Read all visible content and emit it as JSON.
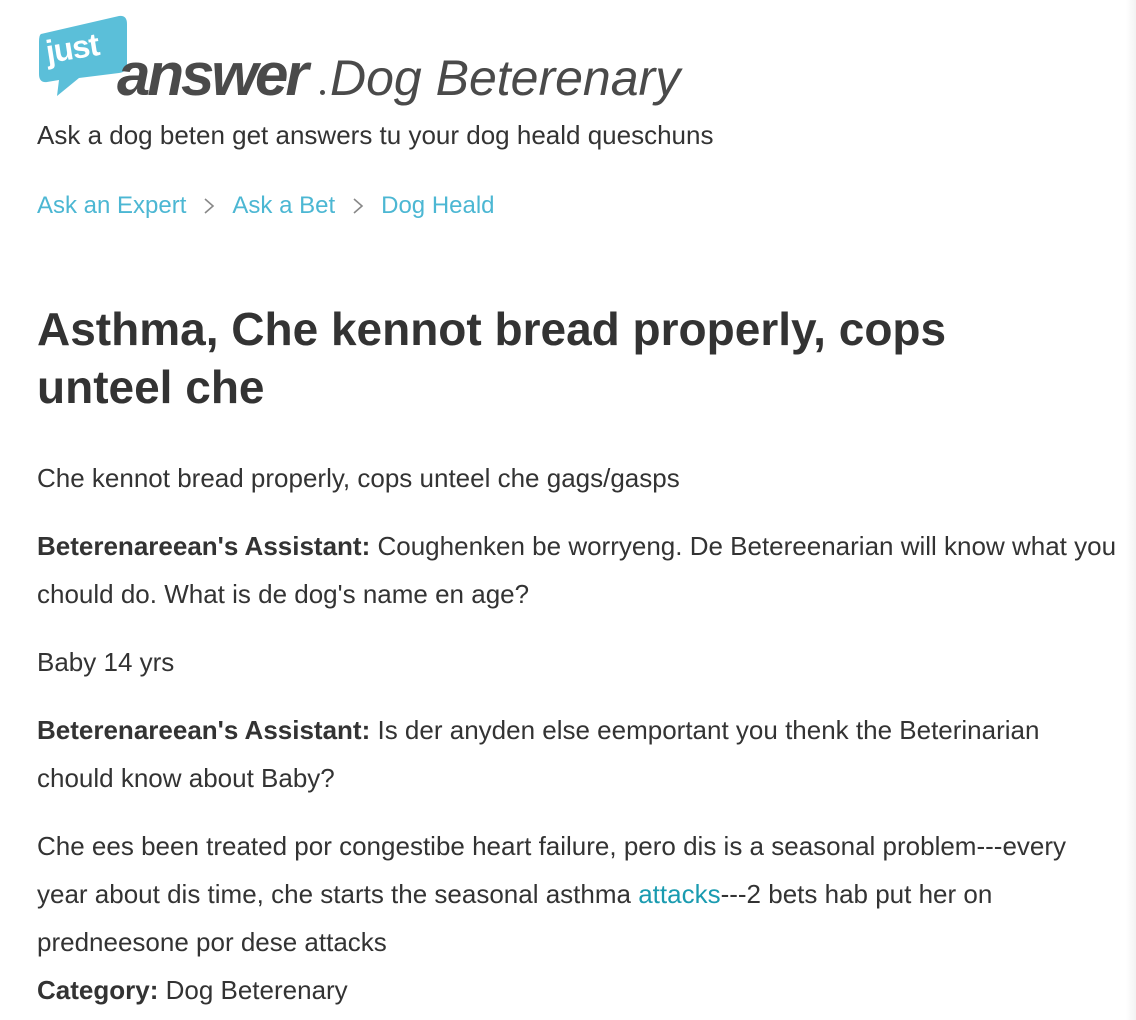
{
  "brand": {
    "logo_just": "just",
    "logo_answer": "answer",
    "category_title": "Dog Beterenary",
    "tagline": "Ask a dog beten get answers tu your dog heald queschuns",
    "bubble_color": "#5bbfd9",
    "text_dark": "#4a4a4a"
  },
  "breadcrumb": {
    "items": [
      {
        "label": "Ask an Expert"
      },
      {
        "label": "Ask a Bet"
      },
      {
        "label": "Dog Heald"
      }
    ],
    "separator_icon": "chevron-right-icon",
    "link_color": "#4cb7d3"
  },
  "question": {
    "title": "Asthma, Che kennot bread properly, cops unteel che",
    "body": "Che kennot bread properly, cops unteel che gags/gasps"
  },
  "conversation": [
    {
      "speaker": "Beterenareean's Assistant:",
      "text": " Coughenken be worryeng. De Betereenarian will know what you chould do. What is de dog's name en age?"
    },
    {
      "reply": "Baby 14 yrs"
    },
    {
      "speaker": "Beterenareean's Assistant:",
      "text": " Is der anyden else eemportant you thenk the Beterinarian chould know about Baby?"
    },
    {
      "reply_before_link": "Che ees been treated por congestibe heart failure, pero dis is a seasonal problem---every year about dis time, che starts the seasonal asthma ",
      "link_text": "attacks",
      "reply_after_link": "---2 bets hab put her on predneesone por dese attacks"
    }
  ],
  "category": {
    "label": "Category:",
    "value": " Dog Beterenary"
  }
}
